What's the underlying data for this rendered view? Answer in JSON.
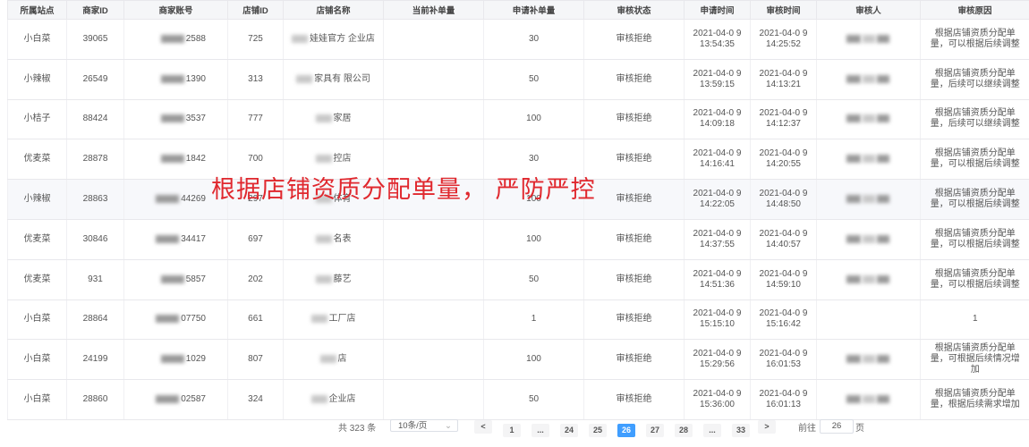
{
  "table": {
    "headers": [
      "所属站点",
      "商家ID",
      "商家账号",
      "店铺ID",
      "店铺名称",
      "当前补单量",
      "申请补单量",
      "审核状态",
      "申请时间",
      "审核时间",
      "审核人",
      "审核原因"
    ],
    "rows": [
      {
        "site": "小白菜",
        "merchant_id": "39065",
        "account": "2588",
        "store_id": "725",
        "store_name": "娃娃官方 企业店",
        "current": "",
        "applied": "30",
        "status": "审核拒绝",
        "apply_time": "2021-04-0 9 13:54:35",
        "review_time": "2021-04-0 9 14:25:52",
        "reason": "根据店铺资质分配单量，可以根据后续调整"
      },
      {
        "site": "小辣椒",
        "merchant_id": "26549",
        "account": "1390",
        "store_id": "313",
        "store_name": "家具有 限公司",
        "current": "",
        "applied": "50",
        "status": "审核拒绝",
        "apply_time": "2021-04-0 9 13:59:15",
        "review_time": "2021-04-0 9 14:13:21",
        "reason": "根据店铺资质分配单量，后续可以继续调整"
      },
      {
        "site": "小桔子",
        "merchant_id": "88424",
        "account": "3537",
        "store_id": "777",
        "store_name": "家居",
        "current": "",
        "applied": "100",
        "status": "审核拒绝",
        "apply_time": "2021-04-0 9 14:09:18",
        "review_time": "2021-04-0 9 14:12:37",
        "reason": "根据店铺资质分配单量，后续可以继续调整"
      },
      {
        "site": "优麦菜",
        "merchant_id": "28878",
        "account": "1842",
        "store_id": "700",
        "store_name": "控店",
        "current": "",
        "applied": "30",
        "status": "审核拒绝",
        "apply_time": "2021-04-0 9 14:16:41",
        "review_time": "2021-04-0 9 14:20:55",
        "reason": "根据店铺资质分配单量，可以根据后续调整"
      },
      {
        "site": "小辣椒",
        "merchant_id": "28863",
        "account": "44269",
        "store_id": "297",
        "store_name": "体育",
        "current": "",
        "applied": "100",
        "status": "审核拒绝",
        "apply_time": "2021-04-0 9 14:22:05",
        "review_time": "2021-04-0 9 14:48:50",
        "reason": "根据店铺资质分配单量，可以根据后续调整"
      },
      {
        "site": "优麦菜",
        "merchant_id": "30846",
        "account": "34417",
        "store_id": "697",
        "store_name": "名表",
        "current": "",
        "applied": "100",
        "status": "审核拒绝",
        "apply_time": "2021-04-0 9 14:37:55",
        "review_time": "2021-04-0 9 14:40:57",
        "reason": "根据店铺资质分配单量，可以根据后续调整"
      },
      {
        "site": "优麦菜",
        "merchant_id": "931",
        "account": "5857",
        "store_id": "202",
        "store_name": "藤艺",
        "current": "",
        "applied": "50",
        "status": "审核拒绝",
        "apply_time": "2021-04-0 9 14:51:36",
        "review_time": "2021-04-0 9 14:59:10",
        "reason": "根据店铺资质分配单量，可以根据后续调整"
      },
      {
        "site": "小白菜",
        "merchant_id": "28864",
        "account": "07750",
        "store_id": "661",
        "store_name": "工厂店",
        "current": "",
        "applied": "1",
        "status": "审核拒绝",
        "apply_time": "2021-04-0 9 15:15:10",
        "review_time": "2021-04-0 9 15:16:42",
        "reason": "1"
      },
      {
        "site": "小白菜",
        "merchant_id": "24199",
        "account": "1029",
        "store_id": "807",
        "store_name": "店",
        "current": "",
        "applied": "100",
        "status": "审核拒绝",
        "apply_time": "2021-04-0 9 15:29:56",
        "review_time": "2021-04-0 9 16:01:53",
        "reason": "根据店铺资质分配单量，可根据后续情况增加"
      },
      {
        "site": "小白菜",
        "merchant_id": "28860",
        "account": "02587",
        "store_id": "324",
        "store_name": "企业店",
        "current": "",
        "applied": "50",
        "status": "审核拒绝",
        "apply_time": "2021-04-0 9 15:36:00",
        "review_time": "2021-04-0 9 16:01:13",
        "reason": "根据店铺资质分配单量，根据后续需求增加"
      }
    ]
  },
  "overlay_text": "根据店铺资质分配单量， 严防严控",
  "pagination": {
    "total": "共 323 条",
    "page_size": "10条/页",
    "pages": [
      "1",
      "...",
      "24",
      "25",
      "26",
      "27",
      "28",
      "...",
      "33"
    ],
    "active_page": "26",
    "goto_label": "前往",
    "goto_value": "26",
    "goto_suffix": "页"
  },
  "colors": {
    "overlay": "#e0282e",
    "active_page": "#409eff"
  }
}
